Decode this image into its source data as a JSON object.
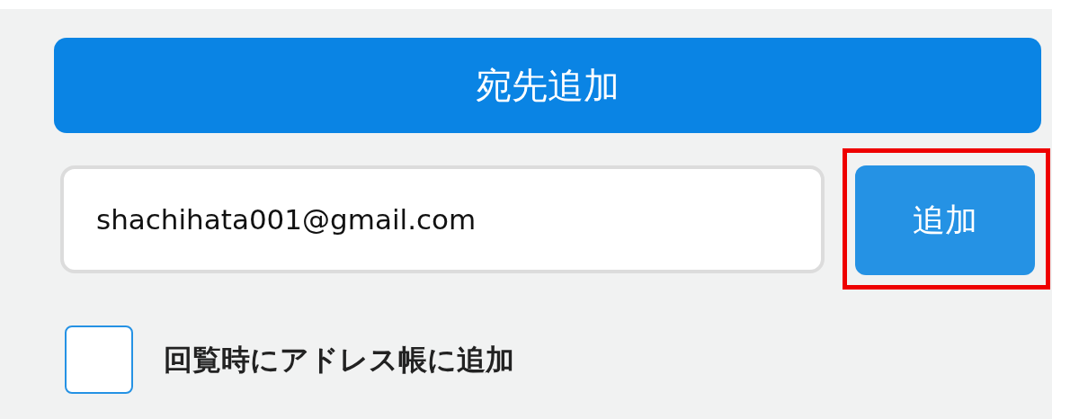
{
  "header_button": {
    "label": "宛先追加"
  },
  "email_field": {
    "value": "shachihata001@gmail.com"
  },
  "add_button": {
    "label": "追加",
    "highlighted": true
  },
  "address_book_option": {
    "label": "回覧時にアドレス帳に追加",
    "checked": false
  }
}
